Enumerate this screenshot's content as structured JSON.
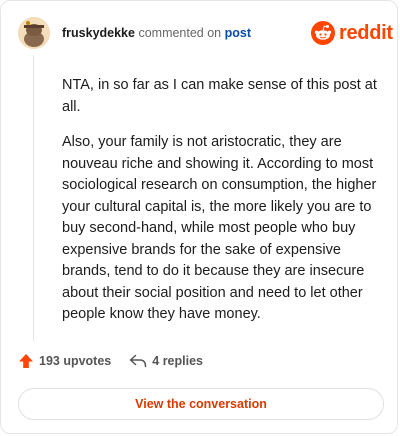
{
  "header": {
    "username": "fruskydekke",
    "action": "commented on",
    "target": "post",
    "brand": "reddit"
  },
  "comment": {
    "paragraphs": [
      "NTA, in so far as I can make sense of this post at all.",
      "Also, your family is not aristocratic, they are nouveau riche and showing it. According to most sociological research on consumption, the higher your cultural capital is, the more likely you are to buy second-hand, while most people who buy expensive brands for the sake of expensive brands, tend to do it because they are insecure about their social position and need to let other people know they have money."
    ]
  },
  "stats": {
    "upvotes": "193 upvotes",
    "replies": "4 replies"
  },
  "cta": {
    "label": "View the conversation"
  },
  "icons": {
    "avatar": "avatar-icon",
    "brand_logo": "reddit-logo-icon",
    "upvote": "upvote-arrow-icon",
    "reply": "reply-arrow-icon"
  },
  "colors": {
    "brand": "#ff4500",
    "link": "#0b4aa2",
    "cta_text": "#d93a00"
  }
}
